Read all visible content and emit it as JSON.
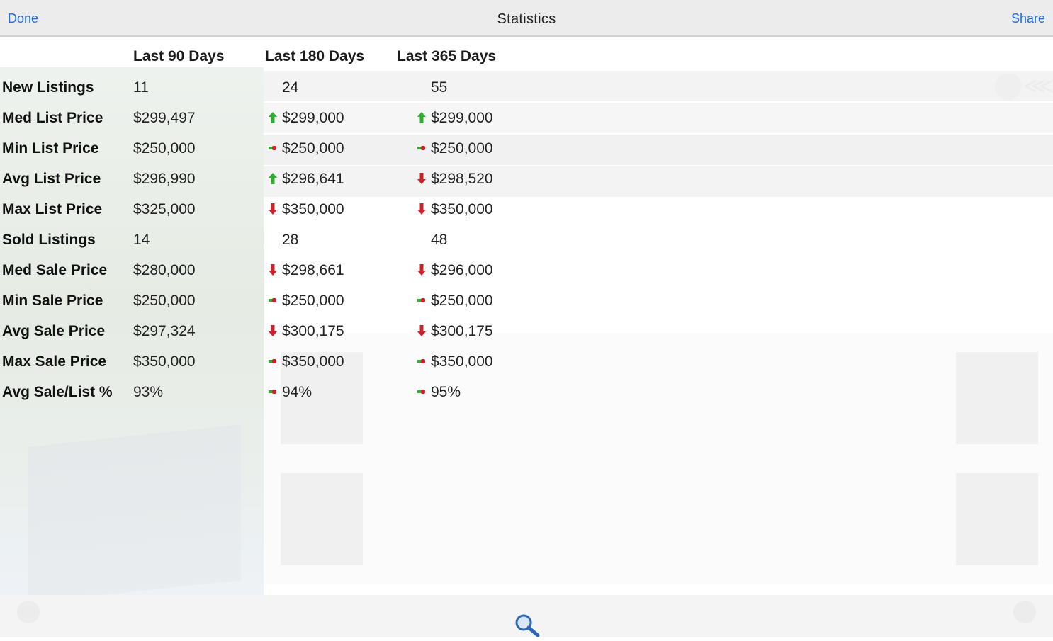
{
  "nav": {
    "done_label": "Done",
    "title": "Statistics",
    "share_label": "Share"
  },
  "stats": {
    "columns": [
      "Last 90 Days",
      "Last 180 Days",
      "Last 365 Days"
    ],
    "rows": [
      {
        "label": "New Listings",
        "cells": [
          {
            "value": "11",
            "trend": "none"
          },
          {
            "value": "24",
            "trend": "none"
          },
          {
            "value": "55",
            "trend": "none"
          }
        ]
      },
      {
        "label": "Med List Price",
        "cells": [
          {
            "value": "$299,497",
            "trend": "none"
          },
          {
            "value": "$299,000",
            "trend": "up"
          },
          {
            "value": "$299,000",
            "trend": "up"
          }
        ]
      },
      {
        "label": "Min List Price",
        "cells": [
          {
            "value": "$250,000",
            "trend": "none"
          },
          {
            "value": "$250,000",
            "trend": "same"
          },
          {
            "value": "$250,000",
            "trend": "same"
          }
        ]
      },
      {
        "label": "Avg List Price",
        "cells": [
          {
            "value": "$296,990",
            "trend": "none"
          },
          {
            "value": "$296,641",
            "trend": "up"
          },
          {
            "value": "$298,520",
            "trend": "down"
          }
        ]
      },
      {
        "label": "Max List Price",
        "cells": [
          {
            "value": "$325,000",
            "trend": "none"
          },
          {
            "value": "$350,000",
            "trend": "down"
          },
          {
            "value": "$350,000",
            "trend": "down"
          }
        ]
      },
      {
        "label": "Sold Listings",
        "cells": [
          {
            "value": "14",
            "trend": "none"
          },
          {
            "value": "28",
            "trend": "none"
          },
          {
            "value": "48",
            "trend": "none"
          }
        ]
      },
      {
        "label": "Med Sale Price",
        "cells": [
          {
            "value": "$280,000",
            "trend": "none"
          },
          {
            "value": "$298,661",
            "trend": "down"
          },
          {
            "value": "$296,000",
            "trend": "down"
          }
        ]
      },
      {
        "label": "Min Sale Price",
        "cells": [
          {
            "value": "$250,000",
            "trend": "none"
          },
          {
            "value": "$250,000",
            "trend": "same"
          },
          {
            "value": "$250,000",
            "trend": "same"
          }
        ]
      },
      {
        "label": "Avg Sale Price",
        "cells": [
          {
            "value": "$297,324",
            "trend": "none"
          },
          {
            "value": "$300,175",
            "trend": "down"
          },
          {
            "value": "$300,175",
            "trend": "down"
          }
        ]
      },
      {
        "label": "Max Sale Price",
        "cells": [
          {
            "value": "$350,000",
            "trend": "none"
          },
          {
            "value": "$350,000",
            "trend": "same"
          },
          {
            "value": "$350,000",
            "trend": "same"
          }
        ]
      },
      {
        "label": "Avg Sale/List %",
        "cells": [
          {
            "value": "93%",
            "trend": "none"
          },
          {
            "value": "94%",
            "trend": "same"
          },
          {
            "value": "95%",
            "trend": "same"
          }
        ]
      }
    ]
  },
  "colors": {
    "accent": "#1f6fe0",
    "trend_up": "#2fae2f",
    "trend_down": "#d0202a",
    "trend_same_left": "#2fae2f",
    "trend_same_right": "#d0202a"
  },
  "icons": {
    "up": "arrow-up-icon",
    "down": "arrow-down-icon",
    "same": "unchanged-icon",
    "search": "search-icon"
  }
}
